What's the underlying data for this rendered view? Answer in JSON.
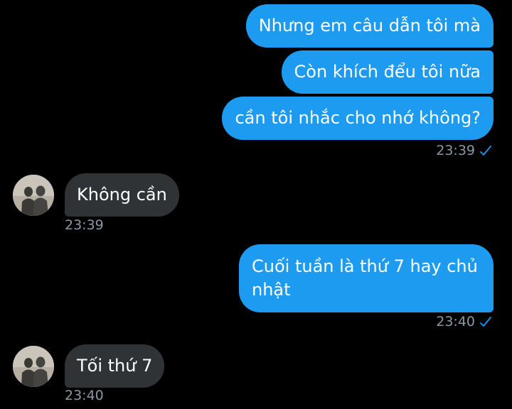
{
  "messages": {
    "m1": "Nhưng em câu dẫn tôi mà",
    "m2": "Còn khích đểu tôi nữa",
    "m3": "cần tôi nhắc cho nhớ không?",
    "t1": "23:39",
    "m4": "Không cần",
    "t2": "23:39",
    "m5": "Cuối tuần là thứ 7 hay chủ nhật",
    "t3": "23:40",
    "m6": "Tối thứ 7",
    "t4": "23:40"
  },
  "icons": {
    "read_receipt": "check-icon",
    "contact_avatar": "avatar"
  },
  "colors": {
    "outgoing_bubble": "#1d9bf0",
    "incoming_bubble": "#2f3336",
    "timestamp": "#8b98a5",
    "check": "#1d9bf0",
    "background": "#000000"
  }
}
